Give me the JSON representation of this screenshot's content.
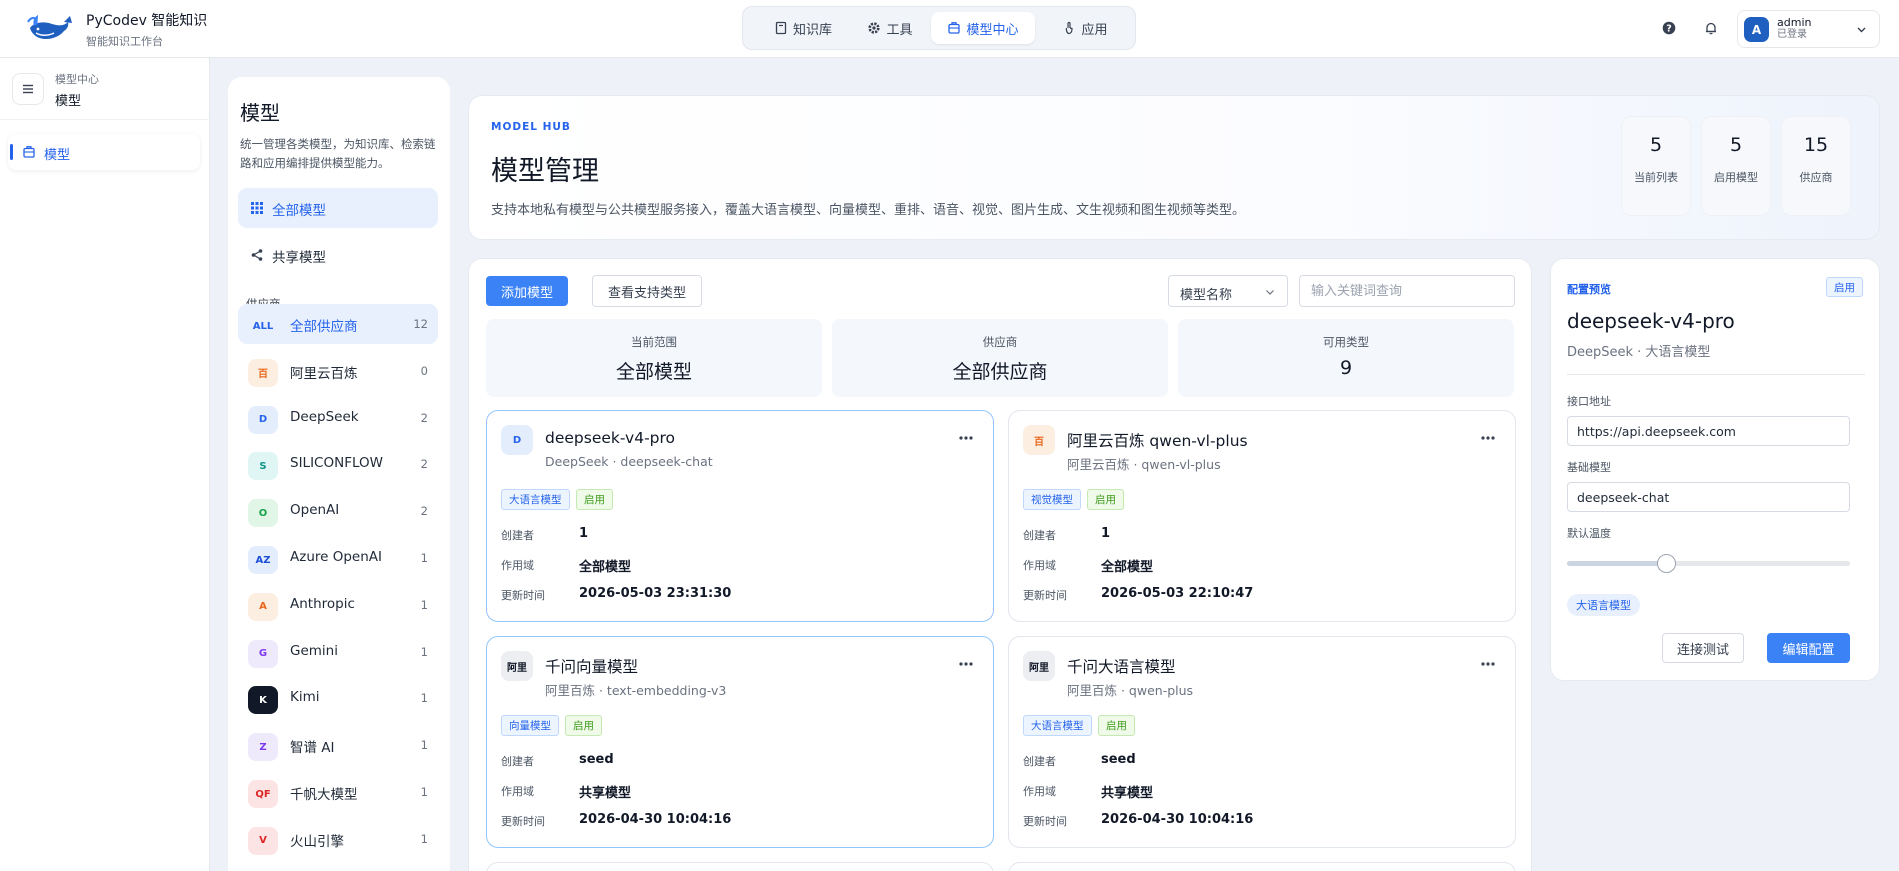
{
  "app": {
    "title": "PyCodev 智能知识",
    "subtitle": "智能知识工作台"
  },
  "topnav": {
    "tabs": [
      {
        "label": "知识库",
        "icon": "book-icon"
      },
      {
        "label": "工具",
        "icon": "gear-icon"
      },
      {
        "label": "模型中心",
        "icon": "box-icon",
        "active": true
      },
      {
        "label": "应用",
        "icon": "hand-icon"
      }
    ]
  },
  "user": {
    "avatar": "A",
    "name": "admin",
    "status": "已登录"
  },
  "sidebar": {
    "breadcrumb_parent": "模型中心",
    "breadcrumb_current": "模型",
    "items": [
      {
        "label": "模型",
        "active": true
      }
    ]
  },
  "model_panel": {
    "title": "模型",
    "description": "统一管理各类模型，为知识库、检索链路和应用编排提供模型能力。",
    "filters": [
      {
        "label": "全部模型",
        "active": true
      },
      {
        "label": "共享模型",
        "active": false
      }
    ],
    "provider_section": "供应商",
    "providers": [
      {
        "badge": "ALL",
        "name": "全部供应商",
        "count": "12",
        "bg": "#e9f0fd",
        "fg": "#2563eb",
        "active": true
      },
      {
        "badge": "百",
        "name": "阿里云百炼",
        "count": "0",
        "bg": "#fdeee2",
        "fg": "#e8671b"
      },
      {
        "badge": "D",
        "name": "DeepSeek",
        "count": "2",
        "bg": "#e4edfc",
        "fg": "#2563eb"
      },
      {
        "badge": "S",
        "name": "SILICONFLOW",
        "count": "2",
        "bg": "#dff6f4",
        "fg": "#0f9488"
      },
      {
        "badge": "O",
        "name": "OpenAI",
        "count": "2",
        "bg": "#e2f6e8",
        "fg": "#16a34a"
      },
      {
        "badge": "AZ",
        "name": "Azure OpenAI",
        "count": "1",
        "bg": "#e4edfc",
        "fg": "#1d4ed8"
      },
      {
        "badge": "A",
        "name": "Anthropic",
        "count": "1",
        "bg": "#fdeee2",
        "fg": "#e8671b"
      },
      {
        "badge": "G",
        "name": "Gemini",
        "count": "1",
        "bg": "#efe9fc",
        "fg": "#7c3aed"
      },
      {
        "badge": "K",
        "name": "Kimi",
        "count": "1",
        "bg": "#111827",
        "fg": "#ffffff"
      },
      {
        "badge": "Z",
        "name": "智谱 AI",
        "count": "1",
        "bg": "#efe9fc",
        "fg": "#7c3aed"
      },
      {
        "badge": "QF",
        "name": "千帆大模型",
        "count": "1",
        "bg": "#fde4e4",
        "fg": "#dc2626"
      },
      {
        "badge": "V",
        "name": "火山引擎",
        "count": "1",
        "bg": "#fde4e4",
        "fg": "#dc2626"
      }
    ]
  },
  "hero": {
    "kicker": "MODEL HUB",
    "title": "模型管理",
    "description": "支持本地私有模型与公共模型服务接入，覆盖大语言模型、向量模型、重排、语音、视觉、图片生成、文生视频和图生视频等类型。",
    "stats": [
      {
        "value": "5",
        "label": "当前列表"
      },
      {
        "value": "5",
        "label": "启用模型"
      },
      {
        "value": "15",
        "label": "供应商"
      }
    ]
  },
  "toolbar": {
    "add_label": "添加模型",
    "types_label": "查看支持类型",
    "select_value": "模型名称",
    "search_placeholder": "输入关键词查询"
  },
  "summary": [
    {
      "label": "当前范围",
      "value": "全部模型"
    },
    {
      "label": "供应商",
      "value": "全部供应商"
    },
    {
      "label": "可用类型",
      "value": "9"
    }
  ],
  "meta_labels": {
    "creator": "创建者",
    "scope": "作用域",
    "updated": "更新时间"
  },
  "models": [
    {
      "badge": "D",
      "badge_bg": "#e4edfc",
      "badge_fg": "#2563eb",
      "name": "deepseek-v4-pro",
      "subtitle": "DeepSeek · deepseek-chat",
      "type_tag": "大语言模型",
      "status_tag": "启用",
      "creator": "1",
      "scope": "全部模型",
      "updated": "2026-05-03 23:31:30",
      "selected": true
    },
    {
      "badge": "百",
      "badge_bg": "#fdeee2",
      "badge_fg": "#e8671b",
      "name": "阿里云百炼 qwen-vl-plus",
      "subtitle": "阿里云百炼 · qwen-vl-plus",
      "type_tag": "视觉模型",
      "status_tag": "启用",
      "creator": "1",
      "scope": "全部模型",
      "updated": "2026-05-03 22:10:47",
      "selected": false
    },
    {
      "badge": "阿里",
      "badge_bg": "#eceef2",
      "badge_fg": "#111827",
      "name": "千问向量模型",
      "subtitle": "阿里百炼 · text-embedding-v3",
      "type_tag": "向量模型",
      "status_tag": "启用",
      "creator": "seed",
      "scope": "共享模型",
      "updated": "2026-04-30 10:04:16",
      "selected": true
    },
    {
      "badge": "阿里",
      "badge_bg": "#eceef2",
      "badge_fg": "#111827",
      "name": "千问大语言模型",
      "subtitle": "阿里百炼 · qwen-plus",
      "type_tag": "大语言模型",
      "status_tag": "启用",
      "creator": "seed",
      "scope": "共享模型",
      "updated": "2026-04-30 10:04:16",
      "selected": false
    }
  ],
  "preview": {
    "kicker": "配置预览",
    "status": "启用",
    "name": "deepseek-v4-pro",
    "subtitle": "DeepSeek · 大语言模型",
    "endpoint_label": "接口地址",
    "endpoint": "https://api.deepseek.com",
    "base_model_label": "基础模型",
    "base_model": "deepseek-chat",
    "temperature_label": "默认温度",
    "temperature_fraction": 0.35,
    "type_tag": "大语言模型",
    "test_label": "连接测试",
    "edit_label": "编辑配置"
  },
  "colors": {
    "accent": "#3b82f6",
    "accent_dark": "#2563eb",
    "page_bg": "#eef1f7"
  }
}
